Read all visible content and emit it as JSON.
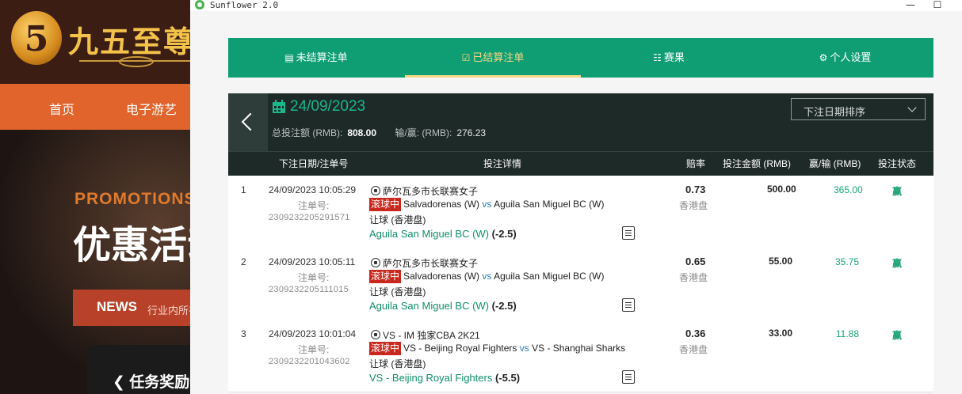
{
  "background_site": {
    "logo_text": "九五至尊",
    "logo_mark": "5",
    "nav": [
      "首页",
      "电子游艺"
    ],
    "promo_en": "PROMOTIONS",
    "promo_cn": "优惠活动",
    "news_title": "NEWS",
    "news_sub": "行业内所有",
    "task_label": "任务奖励"
  },
  "window": {
    "title": "Sunflower 2.0",
    "minimize": "—",
    "maximize": "☐"
  },
  "tabs": [
    {
      "label": "未结算注单",
      "icon": "📋",
      "active": false
    },
    {
      "label": "已结算注单",
      "icon": "✅",
      "active": true
    },
    {
      "label": "赛果",
      "icon": "📊",
      "active": false
    },
    {
      "label": "个人设置",
      "icon": "⚙",
      "active": false
    }
  ],
  "summary": {
    "date": "24/09/2023",
    "total_stake_label": "总投注额 (RMB):",
    "total_stake": "808.00",
    "win_loss_label": "输/赢: (RMB):",
    "win_loss": "276.23",
    "sort_label": "下注日期排序"
  },
  "table": {
    "headers": {
      "date": "下注日期/注单号",
      "details": "投注详情",
      "odds": "赔率",
      "stake": "投注金额 (RMB)",
      "winloss": "赢/输 (RMB)",
      "status": "投注状态"
    },
    "rows": [
      {
        "num": "1",
        "datetime": "24/09/2023 10:05:29",
        "ticket_label": "注单号:",
        "ticket": "2309232205291571",
        "league": "萨尔瓦多市长联赛女子",
        "live": "滚球中",
        "home": "Salvadorenas (W)",
        "vs": "vs",
        "away": "Aguila San Miguel BC (W)",
        "market": "让球 (香港盘)",
        "selection": "Aguila San Miguel BC (W)",
        "handicap": "(-2.5)",
        "odds": "0.73",
        "odds_type": "香港盘",
        "stake": "500.00",
        "winloss": "365.00",
        "status": "赢"
      },
      {
        "num": "2",
        "datetime": "24/09/2023 10:05:11",
        "ticket_label": "注单号:",
        "ticket": "2309232205111015",
        "league": "萨尔瓦多市长联赛女子",
        "live": "滚球中",
        "home": "Salvadorenas (W)",
        "vs": "vs",
        "away": "Aguila San Miguel BC (W)",
        "market": "让球 (香港盘)",
        "selection": "Aguila San Miguel BC (W)",
        "handicap": "(-2.5)",
        "odds": "0.65",
        "odds_type": "香港盘",
        "stake": "55.00",
        "winloss": "35.75",
        "status": "赢"
      },
      {
        "num": "3",
        "datetime": "24/09/2023 10:01:04",
        "ticket_label": "注单号:",
        "ticket": "2309232201043602",
        "league": "VS - IM 独家CBA 2K21",
        "live": "滚球中",
        "home": "VS - Beijing Royal Fighters",
        "vs": "vs",
        "away": "VS - Shanghai Sharks",
        "market": "让球 (香港盘)",
        "selection": "VS - Beijing Royal Fighters",
        "handicap": "(-5.5)",
        "odds": "0.36",
        "odds_type": "香港盘",
        "stake": "33.00",
        "winloss": "11.88",
        "status": "赢"
      }
    ]
  },
  "colors": {
    "tab_bar": "#0f9e73",
    "active_tab": "#f5d783",
    "header_dark": "#1e2a28",
    "live_badge": "#c8281e",
    "win_green": "#19a374"
  }
}
